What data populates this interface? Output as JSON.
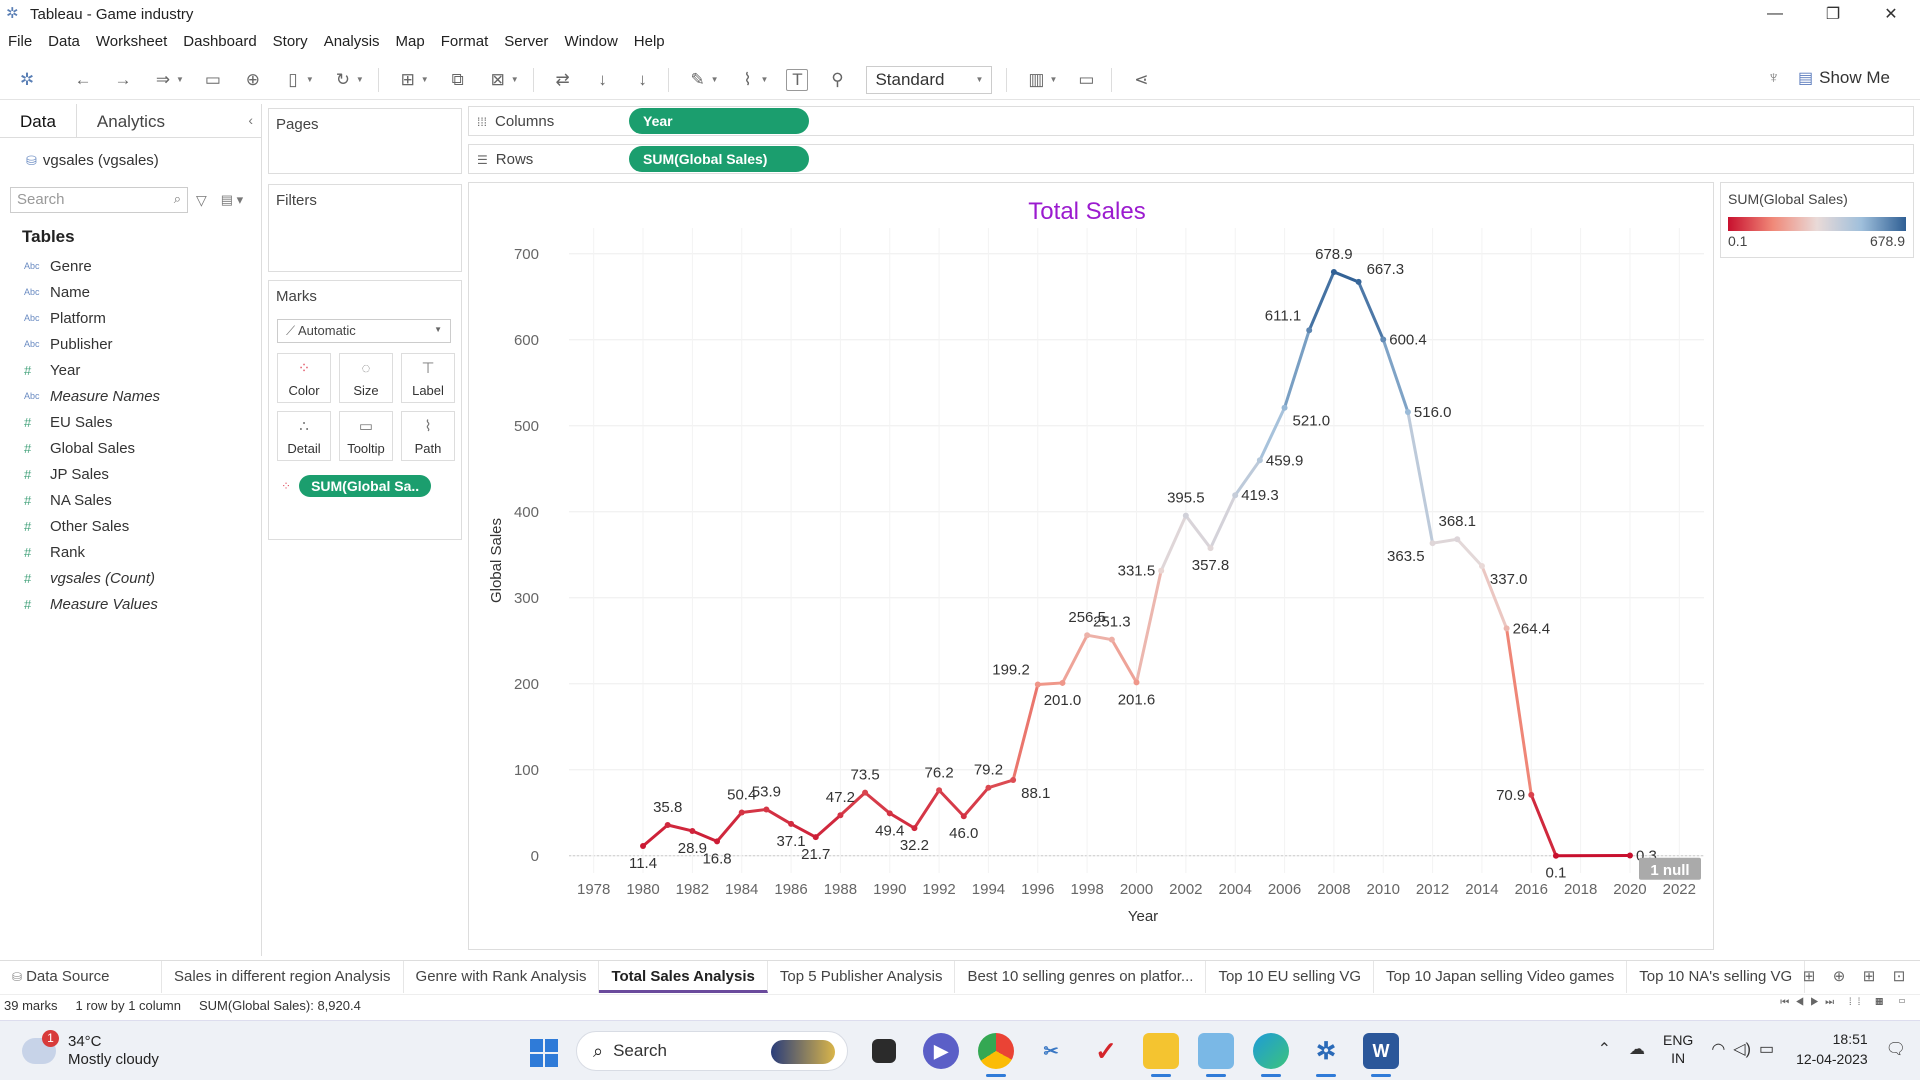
{
  "window": {
    "title": "Tableau - Game industry",
    "minimize": "—",
    "restore": "❐",
    "close": "✕"
  },
  "menu": [
    "File",
    "Data",
    "Worksheet",
    "Dashboard",
    "Story",
    "Analysis",
    "Map",
    "Format",
    "Server",
    "Window",
    "Help"
  ],
  "toolbar": {
    "fit_select": "Standard",
    "show_me": "Show Me"
  },
  "data_pane": {
    "tabs": [
      "Data",
      "Analytics"
    ],
    "datasource": "vgsales (vgsales)",
    "search_placeholder": "Search",
    "tables_header": "Tables",
    "fields": [
      {
        "type": "Abc",
        "name": "Genre",
        "measure": false,
        "italic": false
      },
      {
        "type": "Abc",
        "name": "Name",
        "measure": false,
        "italic": false
      },
      {
        "type": "Abc",
        "name": "Platform",
        "measure": false,
        "italic": false
      },
      {
        "type": "Abc",
        "name": "Publisher",
        "measure": false,
        "italic": false
      },
      {
        "type": "#",
        "name": "Year",
        "measure": true,
        "italic": false
      },
      {
        "type": "Abc",
        "name": "Measure Names",
        "measure": false,
        "italic": true
      },
      {
        "type": "#",
        "name": "EU Sales",
        "measure": true,
        "italic": false
      },
      {
        "type": "#",
        "name": "Global Sales",
        "measure": true,
        "italic": false
      },
      {
        "type": "#",
        "name": "JP Sales",
        "measure": true,
        "italic": false
      },
      {
        "type": "#",
        "name": "NA Sales",
        "measure": true,
        "italic": false
      },
      {
        "type": "#",
        "name": "Other Sales",
        "measure": true,
        "italic": false
      },
      {
        "type": "#",
        "name": "Rank",
        "measure": true,
        "italic": false
      },
      {
        "type": "#",
        "name": "vgsales (Count)",
        "measure": true,
        "italic": true
      },
      {
        "type": "#",
        "name": "Measure Values",
        "measure": true,
        "italic": true
      }
    ]
  },
  "shelves": {
    "pages": "Pages",
    "filters": "Filters",
    "marks": "Marks",
    "mark_type": "Automatic",
    "mark_buttons": [
      {
        "label": "Color",
        "icon": "color-icon"
      },
      {
        "label": "Size",
        "icon": "size-icon"
      },
      {
        "label": "Label",
        "icon": "label-icon"
      },
      {
        "label": "Detail",
        "icon": "detail-icon"
      },
      {
        "label": "Tooltip",
        "icon": "tooltip-icon"
      },
      {
        "label": "Path",
        "icon": "path-icon"
      }
    ],
    "marks_pill": "SUM(Global Sa..",
    "columns_label": "Columns",
    "columns_pill": "Year",
    "rows_label": "Rows",
    "rows_pill": "SUM(Global Sales)"
  },
  "legend": {
    "title": "SUM(Global Sales)",
    "min": "0.1",
    "max": "678.9"
  },
  "chart_data": {
    "type": "line",
    "title": "Total Sales",
    "xlabel": "Year",
    "ylabel": "Global Sales",
    "xlim": [
      1977,
      2023
    ],
    "ylim": [
      -20,
      730
    ],
    "x_ticks": [
      1978,
      1980,
      1982,
      1984,
      1986,
      1988,
      1990,
      1992,
      1994,
      1996,
      1998,
      2000,
      2002,
      2004,
      2006,
      2008,
      2010,
      2012,
      2014,
      2016,
      2018,
      2020,
      2022
    ],
    "y_ticks": [
      0,
      100,
      200,
      300,
      400,
      500,
      600,
      700
    ],
    "x": [
      1980,
      1981,
      1982,
      1983,
      1984,
      1985,
      1986,
      1987,
      1988,
      1989,
      1990,
      1991,
      1992,
      1993,
      1994,
      1995,
      1996,
      1997,
      1998,
      1999,
      2000,
      2001,
      2002,
      2003,
      2004,
      2005,
      2006,
      2007,
      2008,
      2009,
      2010,
      2011,
      2012,
      2013,
      2014,
      2015,
      2016,
      2017,
      2020
    ],
    "values": [
      11.4,
      35.8,
      28.9,
      16.8,
      50.4,
      53.9,
      37.1,
      21.7,
      47.2,
      73.5,
      49.4,
      32.2,
      76.2,
      46.0,
      79.2,
      88.1,
      199.2,
      201.0,
      256.5,
      251.3,
      201.6,
      331.5,
      395.5,
      357.8,
      419.3,
      459.9,
      521.0,
      611.1,
      678.9,
      667.3,
      600.4,
      516.0,
      363.5,
      368.1,
      337.0,
      264.4,
      70.9,
      0.1,
      0.3
    ],
    "labels": [
      "11.4",
      "35.8",
      "28.9",
      "16.8",
      "50.4",
      "53.9",
      "37.1",
      "21.7",
      "47.2",
      "73.5",
      "49.4",
      "32.2",
      "76.2",
      "46.0",
      "79.2",
      "88.1",
      "199.2",
      "201.0",
      "256.5",
      "251.3",
      "201.6",
      "331.5",
      "395.5",
      "357.8",
      "419.3",
      "459.9",
      "521.0",
      "611.1",
      "678.9",
      "667.3",
      "600.4",
      "516.0",
      "363.5",
      "368.1",
      "337.0",
      "264.4",
      "70.9",
      "0.1",
      "0.3"
    ],
    "label_pos": [
      "b",
      "t",
      "b",
      "b",
      "t",
      "t",
      "b",
      "b",
      "t",
      "t",
      "b",
      "b",
      "t",
      "b",
      "t",
      "br",
      "tl",
      "b",
      "t",
      "t",
      "b",
      "l",
      "t",
      "b",
      "r",
      "r",
      "br",
      "tl",
      "t",
      "tr",
      "r",
      "r",
      "bl",
      "t",
      "br",
      "r",
      "l",
      "b",
      "r"
    ],
    "null_indicator": "1 null",
    "color_scale": [
      "#c8102e",
      "#f08878",
      "#e9dad8",
      "#9fbfdb",
      "#2f5f94"
    ],
    "grid": true
  },
  "sheet_tabs": {
    "datasource": "Data Source",
    "tabs": [
      "Sales in different region Analysis",
      "Genre with Rank Analysis",
      "Total Sales Analysis",
      "Top 5 Publisher Analysis",
      "Best 10 selling genres on platfor...",
      "Top 10 EU selling VG",
      "Top 10 Japan selling Video games",
      "Top 10 NA's  selling VG"
    ],
    "active": "Total Sales Analysis"
  },
  "status": {
    "marks": "39 marks",
    "rows": "1 row by 1 column",
    "sum": "SUM(Global Sales): 8,920.4"
  },
  "taskbar": {
    "weather_badge": "1",
    "temp": "34°C",
    "condition": "Mostly cloudy",
    "search": "Search",
    "lang1": "ENG",
    "lang2": "IN",
    "time": "18:51",
    "date": "12-04-2023"
  }
}
